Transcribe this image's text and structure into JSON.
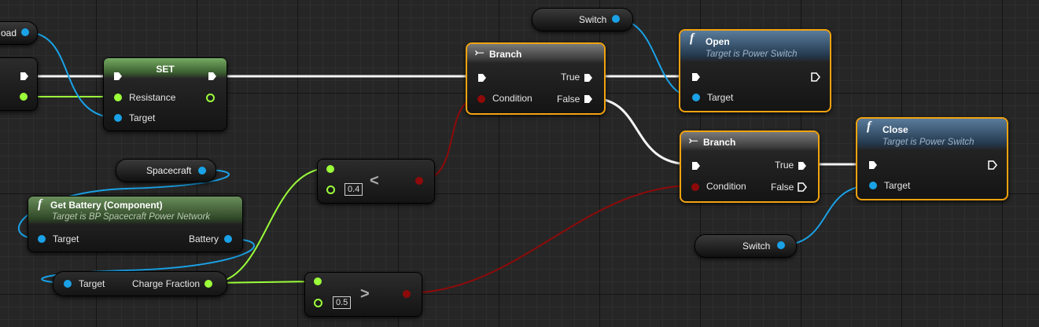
{
  "vars": {
    "top_left_partial": "oad",
    "switch_top": "Switch",
    "spacecraft": "Spacecraft",
    "switch_bottom": "Switch"
  },
  "set_node": {
    "title": "SET",
    "pin_resistance": "Resistance",
    "pin_target": "Target"
  },
  "get_battery": {
    "title": "Get Battery (Component)",
    "subtitle": "Target is BP Spacecraft Power Network",
    "pin_target": "Target",
    "pin_battery": "Battery"
  },
  "charge_node": {
    "pin_target": "Target",
    "pin_charge": "Charge Fraction"
  },
  "less_node": {
    "value": "0.4",
    "op": "<"
  },
  "greater_node": {
    "value": "0.5",
    "op": ">"
  },
  "branch1": {
    "title": "Branch",
    "condition": "Condition",
    "true": "True",
    "false": "False"
  },
  "branch2": {
    "title": "Branch",
    "condition": "Condition",
    "true": "True",
    "false": "False"
  },
  "open_node": {
    "title": "Open",
    "subtitle": "Target is Power Switch",
    "pin_target": "Target"
  },
  "close_node": {
    "title": "Close",
    "subtitle": "Target is Power Switch",
    "pin_target": "Target"
  },
  "colors": {
    "exec": "#ffffff",
    "object": "#1aa1e6",
    "float": "#9bff3a",
    "bool": "#8e0a0a",
    "selected": "#f2a30f"
  }
}
